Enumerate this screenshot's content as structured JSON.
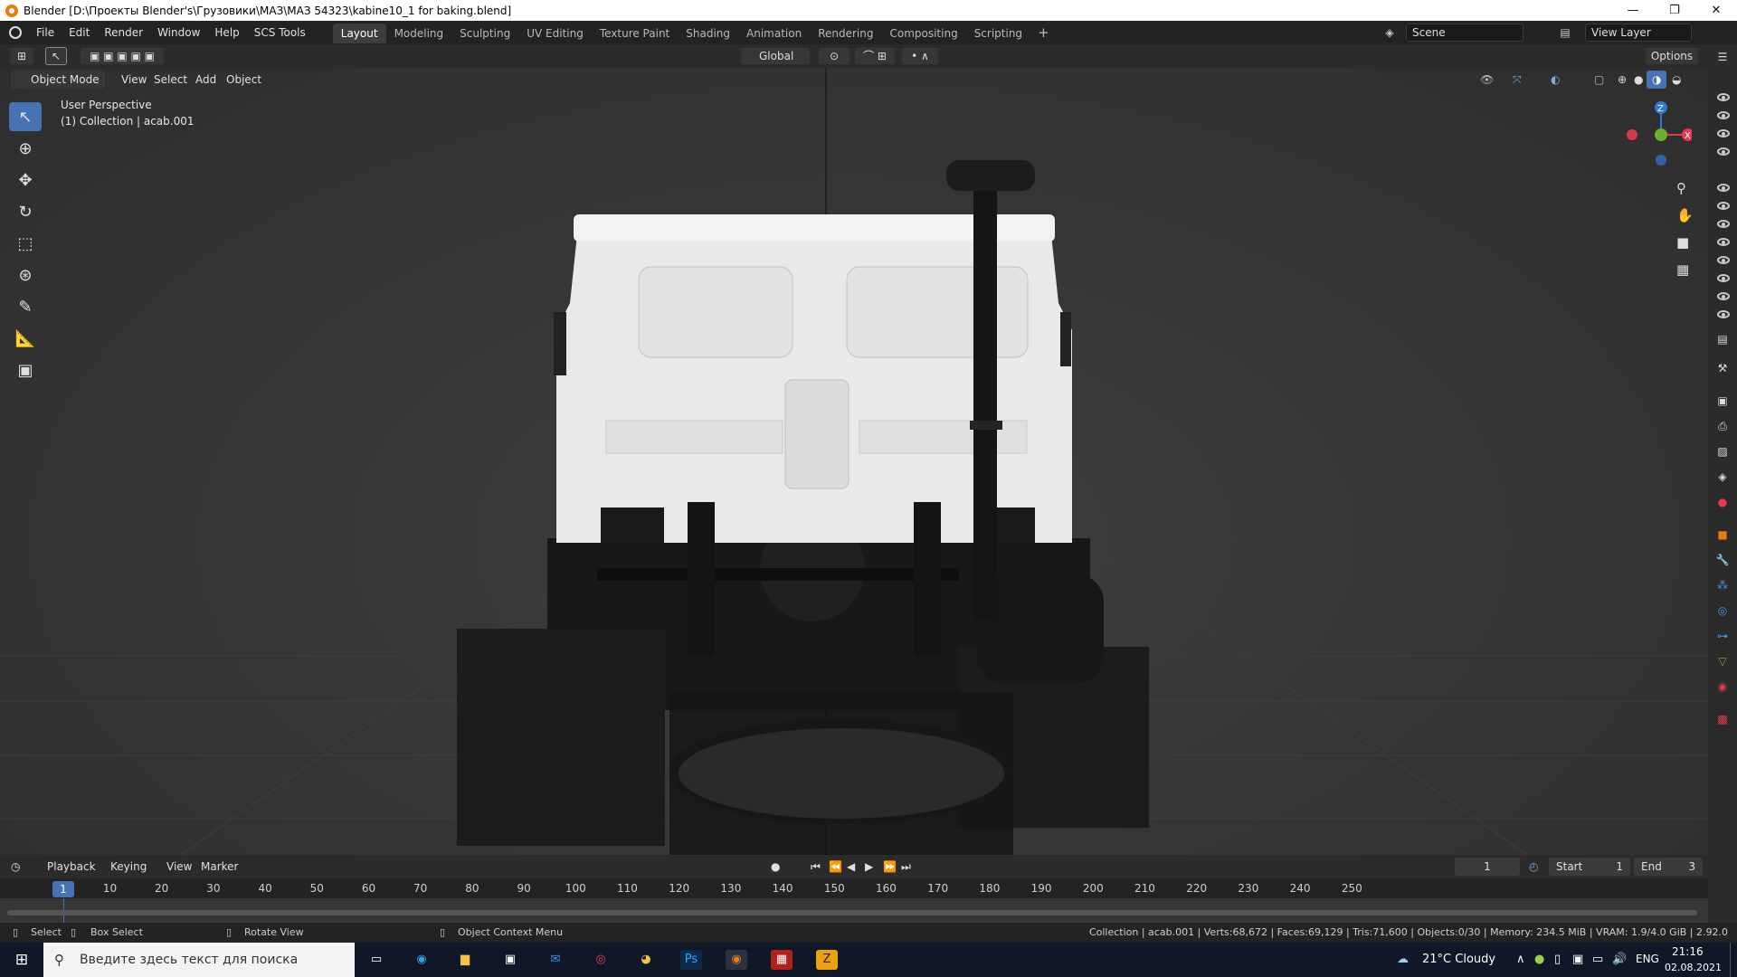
{
  "titlebar": {
    "title": "Blender [D:\\Проекты Blender's\\Грузовики\\МАЗ\\МАЗ 54323\\kabine10_1 for baking.blend]",
    "minimize": "—",
    "restore": "❐",
    "close": "✕"
  },
  "menu": {
    "items": [
      "File",
      "Edit",
      "Render",
      "Window",
      "Help",
      "SCS Tools"
    ],
    "workspaces": [
      "Layout",
      "Modeling",
      "Sculpting",
      "UV Editing",
      "Texture Paint",
      "Shading",
      "Animation",
      "Rendering",
      "Compositing",
      "Scripting"
    ],
    "active_workspace": "Layout",
    "add_workspace": "+",
    "scene": "Scene",
    "view_layer": "View Layer"
  },
  "toolheader": {
    "transform_orientation": "Global",
    "options": "Options"
  },
  "viewport_header": {
    "mode": "Object Mode",
    "items": [
      "View",
      "Select",
      "Add",
      "Object"
    ]
  },
  "viewport": {
    "perspective": "User Perspective",
    "collection_info": "(1) Collection | acab.001",
    "gizmo_labels": {
      "x": "X",
      "y": "Y",
      "z": "Z"
    }
  },
  "timeline": {
    "menus": [
      "Playback",
      "Keying",
      "View",
      "Marker"
    ],
    "current_frame": "1",
    "frame_field": "1",
    "start_label": "Start",
    "start_value": "1",
    "end_label": "End",
    "end_value": "3",
    "ticks": [
      "10",
      "20",
      "30",
      "40",
      "50",
      "60",
      "70",
      "80",
      "90",
      "100",
      "110",
      "120",
      "130",
      "140",
      "150",
      "160",
      "170",
      "180",
      "190",
      "200",
      "210",
      "220",
      "230",
      "240",
      "250"
    ]
  },
  "statusbar": {
    "select": "Select",
    "box_select": "Box Select",
    "rotate_view": "Rotate View",
    "context_menu": "Object Context Menu",
    "stats": "Collection | acab.001 | Verts:68,672 | Faces:69,129 | Tris:71,600 | Objects:0/30 | Memory: 234.5 MiB | VRAM: 1.9/4.0 GiB | 2.92.0"
  },
  "taskbar": {
    "search_placeholder": "Введите здесь текст для поиска",
    "weather": "21°C  Cloudy",
    "language": "ENG",
    "time": "21:16",
    "date": "02.08.2021"
  },
  "colors": {
    "accent": "#4772b3",
    "blender_orange": "#e87d0d",
    "gizmo_x": "#e8384f",
    "gizmo_y": "#6cb02b",
    "gizmo_z": "#2e7bd6"
  }
}
